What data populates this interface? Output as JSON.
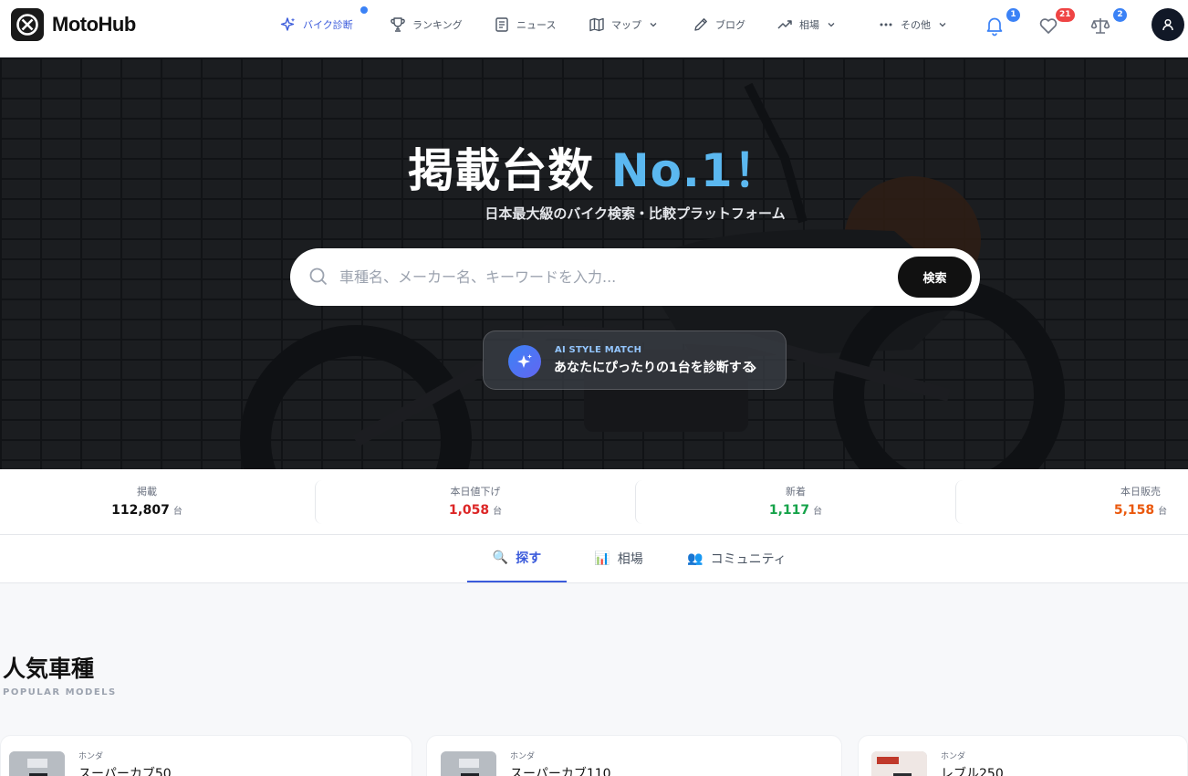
{
  "header": {
    "logo_text": "MotoHub",
    "nav": [
      {
        "label": "バイク診断",
        "icon": "sparkles-icon"
      },
      {
        "label": "ランキング",
        "icon": "trophy-icon"
      },
      {
        "label": "ニュース",
        "icon": "newspaper-icon"
      },
      {
        "label": "マップ",
        "icon": "map-icon"
      },
      {
        "label": "ブログ",
        "icon": "pen-icon"
      },
      {
        "label": "相場",
        "icon": "trend-up-icon"
      },
      {
        "label": "その他",
        "icon": "more-icon"
      }
    ],
    "notifications_count": "1",
    "favorites_count": "21",
    "compare_count": "2"
  },
  "hero": {
    "title": "掲載台数",
    "title_accent": "No.1！",
    "subtitle": "日本最大級のバイク検索・比較プラットフォーム",
    "search_placeholder": "車種名、メーカー名、キーワードを入力...",
    "search_button": "検索",
    "ai_kicker": "AI STYLE MATCH",
    "ai_text": "あなたにぴったりの1台を診断する"
  },
  "stats": [
    {
      "label": "掲載",
      "value": "112,807",
      "unit": "台",
      "color": "#111111"
    },
    {
      "label": "本日値下げ",
      "value": "1,058",
      "unit": "台",
      "color": "#dc2626"
    },
    {
      "label": "新着",
      "value": "1,117",
      "unit": "台",
      "color": "#16a34a"
    },
    {
      "label": "本日販売",
      "value": "5,158",
      "unit": "台",
      "color": "#ea580c"
    }
  ],
  "tabs": [
    {
      "label": "探す",
      "icon": "🔍"
    },
    {
      "label": "相場",
      "icon": "📊"
    },
    {
      "label": "コミュニティ",
      "icon": "👥"
    }
  ],
  "popular": {
    "title": "人気車種",
    "subtitle": "POPULAR MODELS",
    "cards": [
      {
        "maker": "ホンダ",
        "name": "スーパーカブ50"
      },
      {
        "maker": "ホンダ",
        "name": "スーパーカブ110"
      },
      {
        "maker": "ホンダ",
        "name": "レブル250"
      }
    ]
  },
  "colors": {
    "accent": "#3b5bdb",
    "hero_accent": "#5bb8f0"
  }
}
